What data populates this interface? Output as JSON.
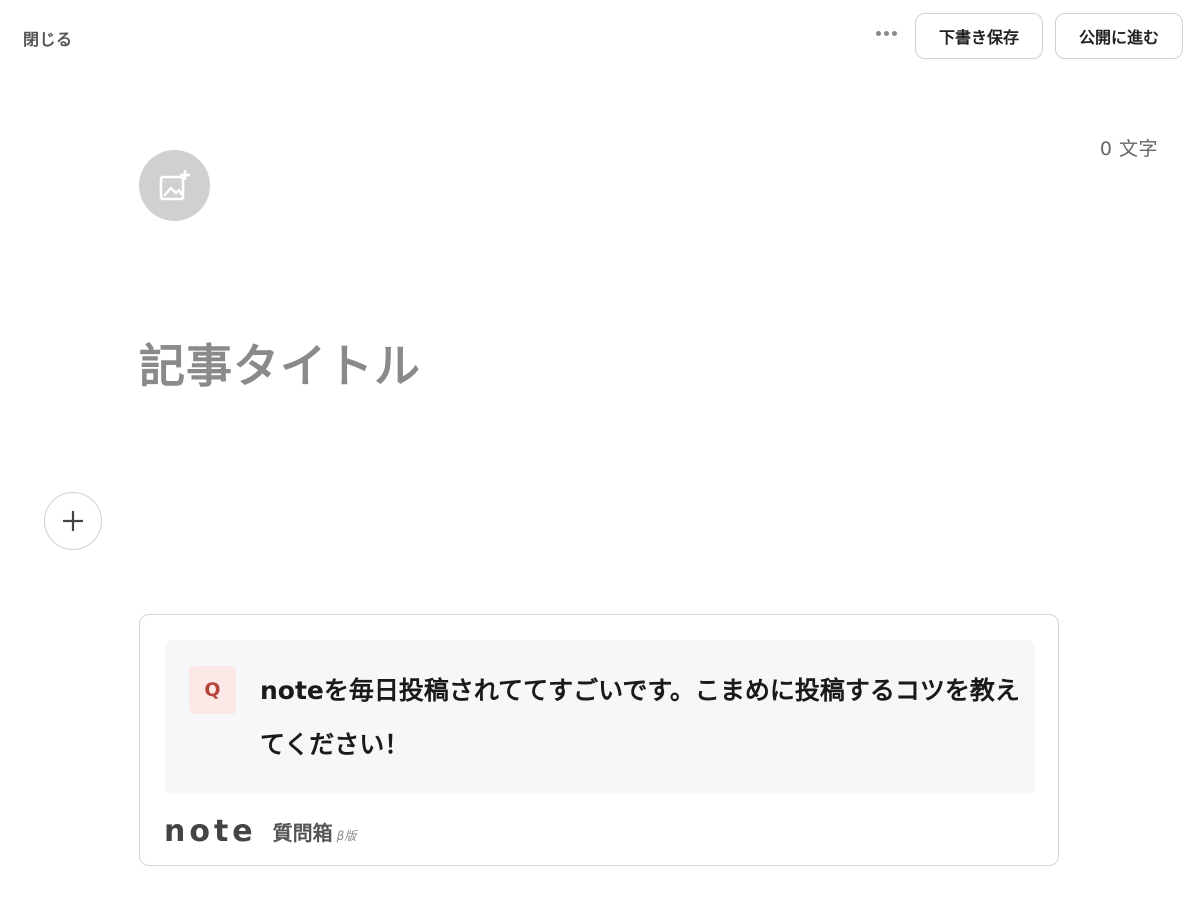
{
  "header": {
    "close_label": "閉じる",
    "more_icon": "more-horizontal-icon",
    "draft_save_label": "下書き保存",
    "publish_label": "公開に進む"
  },
  "editor": {
    "char_count": "0 文字",
    "image_add_icon": "image-add-icon",
    "title_placeholder": "記事タイトル",
    "plus_icon": "plus-icon"
  },
  "question_box": {
    "badge": "Q",
    "question": "noteを毎日投稿されててすごいです。こまめに投稿するコツを教えてください！",
    "logo_text": "note",
    "label": "質問箱",
    "beta": "β版"
  },
  "colors": {
    "badge_bg": "#fde8e8",
    "badge_text": "#b5453b",
    "card_inner_bg": "#f5f7f8"
  }
}
